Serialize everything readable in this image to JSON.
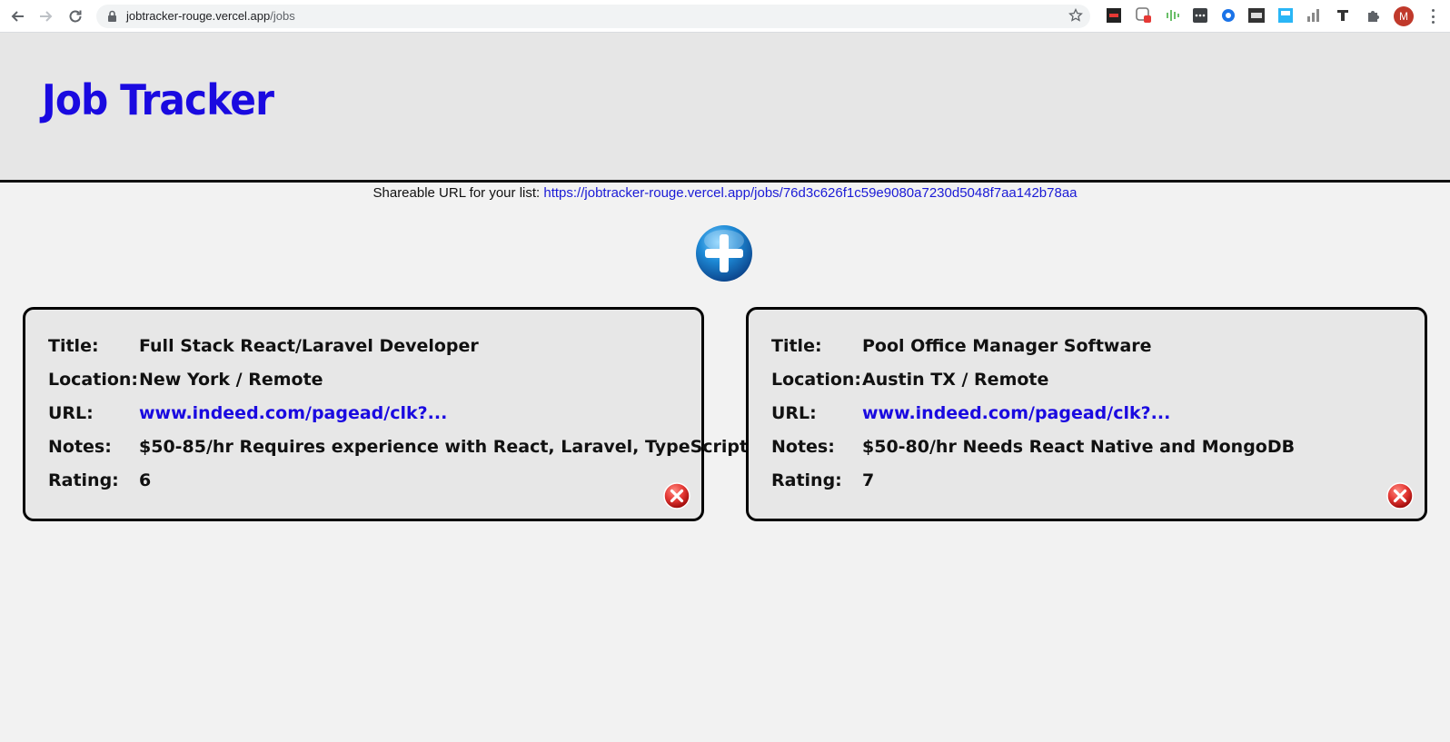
{
  "browser": {
    "url_host": "jobtracker-rouge.vercel.app",
    "url_path": "/jobs",
    "avatar_letter": "M"
  },
  "app": {
    "title": "Job Tracker",
    "share_label": "Shareable URL for your list:",
    "share_url": "https://jobtracker-rouge.vercel.app/jobs/76d3c626f1c59e9080a7230d5048f7aa142b78aa"
  },
  "labels": {
    "title": "Title:",
    "location": "Location:",
    "url": "URL:",
    "notes": "Notes:",
    "rating": "Rating:"
  },
  "jobs": [
    {
      "title": "Full Stack React/Laravel Developer",
      "location": "New York / Remote",
      "url": "www.indeed.com/pagead/clk?...",
      "notes": "$50-85/hr Requires experience with React, Laravel, TypeScript",
      "rating": "6"
    },
    {
      "title": "Pool Office Manager Software",
      "location": "Austin TX / Remote",
      "url": "www.indeed.com/pagead/clk?...",
      "notes": "$50-80/hr Needs React Native and MongoDB",
      "rating": "7"
    }
  ],
  "colors": {
    "title": "#1a0ae0",
    "link": "#1a0ae0",
    "card_bg": "#e7e7e7",
    "page_bg": "#f2f2f2"
  }
}
